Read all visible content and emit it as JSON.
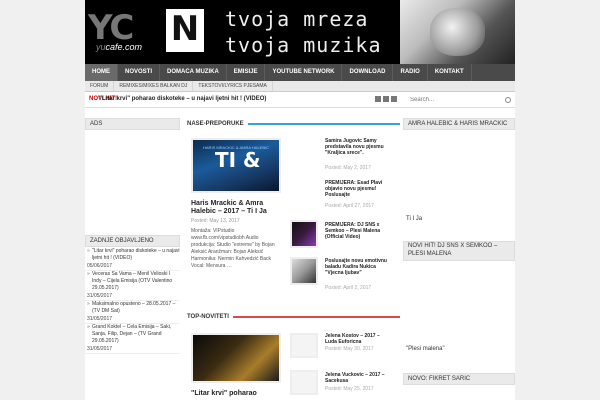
{
  "header": {
    "logo_main": "YC",
    "logo_box": "N",
    "logo_sub_prefix": "yu",
    "logo_sub_suffix": "cafe.com",
    "tagline_line1": "tvoja mreza",
    "tagline_line2": "tvoja muzika"
  },
  "nav": {
    "items": [
      "HOME",
      "NOVOSTI",
      "DOMACA MUZIKA",
      "EMISIJE",
      "YOUTUBE NETWORK",
      "DOWNLOAD",
      "RADIO",
      "KONTAKT"
    ]
  },
  "subnav": {
    "items": [
      "FORUM",
      "REMIXES/MIXES BALKAN DJ",
      "TEKSTOVI/LYRICS PJESAMA"
    ]
  },
  "ticker": {
    "label": "NOVI HIT!",
    "text": "\"Litar krvi\" poharao diskoteke – u najavi ljetni hit ! (VIDEO)"
  },
  "search": {
    "placeholder": "Search..."
  },
  "left_sidebar": {
    "ads_title": "ADS",
    "recent_title": "ZADNJE OBJAVLJENO",
    "recent": [
      {
        "title": "\"Litar krvi\" poharao diskoteke – u najavi ljetni hit ! (VIDEO)",
        "date": "05/06/2017"
      },
      {
        "title": "Veceras Sa Vama – Menil Velioski I Indy – Cijela Emisija (OTV Valentino 29.05.2017)",
        "date": "31/05/2017"
      },
      {
        "title": "Maksimalno opusteno – 28.05.2017 – (TV DM Sat)",
        "date": "31/05/2017"
      },
      {
        "title": "Grand Koktel – Cela Emisija – Saki, Sanja, Filip, Dejan – (TV Grand 29.05.2017)",
        "date": "31/05/2017"
      }
    ]
  },
  "preporuke": {
    "heading": "NASE-PREPORUKE",
    "accent": "#3d9fd8",
    "featured": {
      "title": "Haris Mrackic & Amra Halebic – 2017 – Ti I Ja",
      "date": "Posted: May 13, 2017",
      "excerpt": "Montaža: VIPstudio www.fb.com/vipstudiobh Audio produkcija: Studio \"extreme\" by Bojan Aleksić Aranžman: Bojan Aleksić Harmonika: Nermin Kahvedzić Back Vocal: Mensura …",
      "thumb_big": "TI  &",
      "thumb_small": "HARIS MRACKIC & AMRA HALEBIC"
    },
    "side": [
      {
        "title": "Samira Jugovic Samy predstavila novu pjesmu \"Kraljica srece\".",
        "date": "Posted: May 2, 2017"
      },
      {
        "title": "PREMIJERA: Esad Plavi objavio novu pjesmu! Poslusajte",
        "date": "Posted: April 27, 2017"
      },
      {
        "title": "PREMIJERA: DJ SNS x Semkoo – Plesi Malena (Official Video)",
        "date": "Posted: April 26, 2017"
      },
      {
        "title": "Poslusajte novu emotivnu baladu Kadira Nukica \"Vjecna ljubav\"",
        "date": "Posted: April 2, 2017"
      }
    ]
  },
  "noviteti": {
    "heading": "TOP-NOVITETI",
    "accent": "#d94b4b",
    "featured_title": "\"Litar krvi\" poharao",
    "side": [
      {
        "title": "Jelena Kostov – 2017 – Luda Euforicna",
        "date": "Posted: May 30, 2017"
      },
      {
        "title": "Jelena Vuckovic – 2017 – Sacekusa",
        "date": "Posted: May 25, 2017"
      }
    ]
  },
  "right_sidebar": {
    "w1_title": "AMRA HALEBIC & HARIS MRACKIC",
    "w1_text": "Ti I Ja",
    "w2_title": "NOVI HIT! DJ SNS X SEMKOO – PLESI MALENA",
    "w2_text": "\"Plesi malena\"",
    "w3_title": "NOVO: FIKRET SARIC"
  }
}
